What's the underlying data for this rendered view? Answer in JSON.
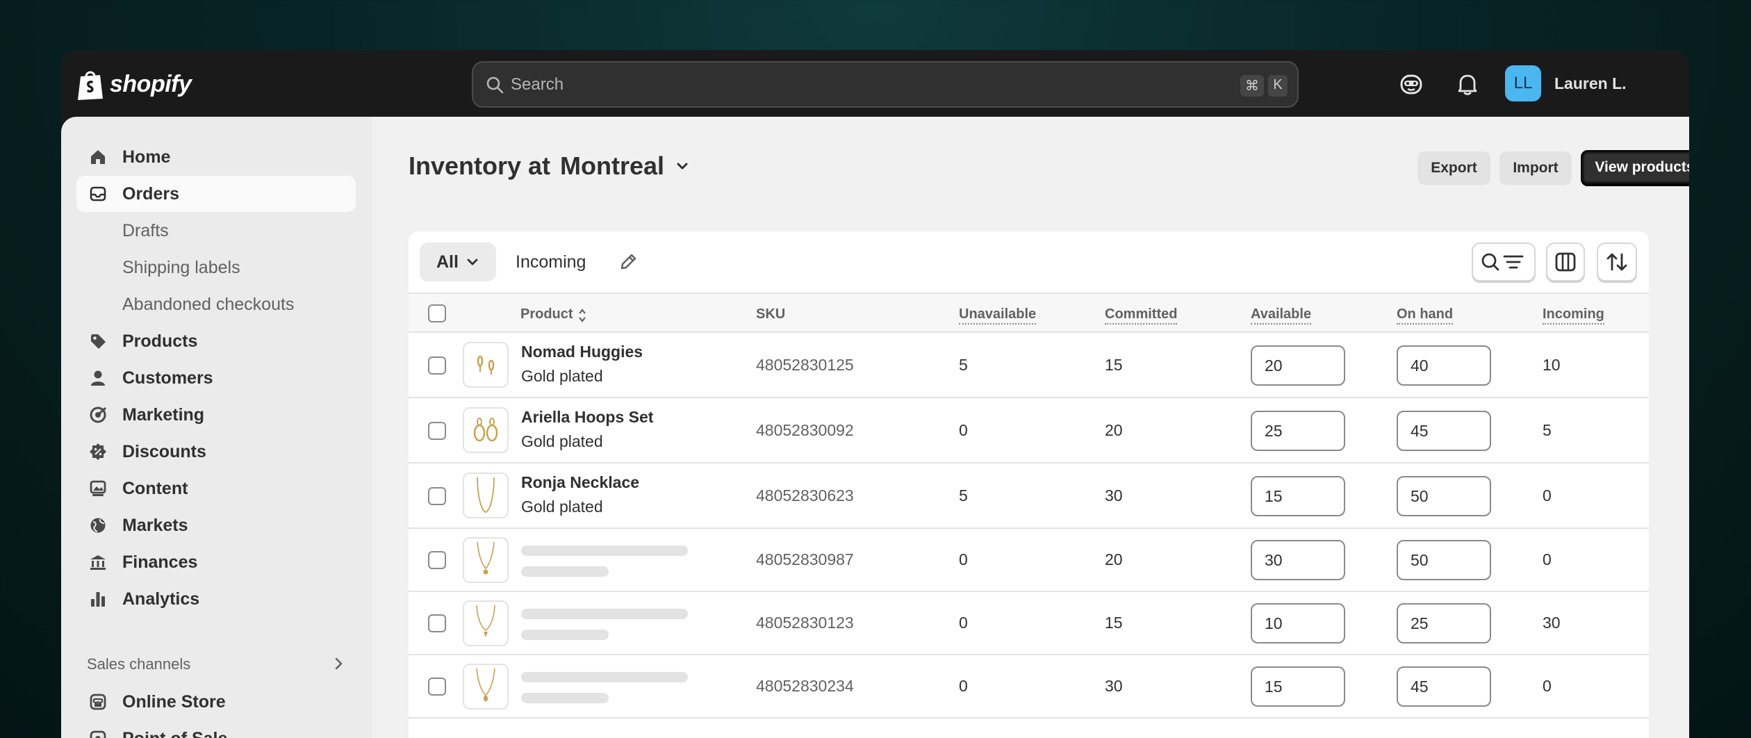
{
  "topbar": {
    "logo_text": "shopify",
    "search_placeholder": "Search",
    "shortcut_keys": [
      "⌘",
      "K"
    ],
    "user_initials": "LL",
    "user_name": "Lauren L."
  },
  "sidebar": {
    "items": [
      {
        "label": "Home",
        "icon": "home-icon"
      },
      {
        "label": "Orders",
        "icon": "orders-icon",
        "active": true
      },
      {
        "label": "Drafts",
        "sub": true
      },
      {
        "label": "Shipping labels",
        "sub": true
      },
      {
        "label": "Abandoned checkouts",
        "sub": true
      },
      {
        "label": "Products",
        "icon": "tag-icon"
      },
      {
        "label": "Customers",
        "icon": "person-icon"
      },
      {
        "label": "Marketing",
        "icon": "target-icon"
      },
      {
        "label": "Discounts",
        "icon": "discount-icon"
      },
      {
        "label": "Content",
        "icon": "content-icon"
      },
      {
        "label": "Markets",
        "icon": "globe-icon"
      },
      {
        "label": "Finances",
        "icon": "bank-icon"
      },
      {
        "label": "Analytics",
        "icon": "bar-chart-icon"
      }
    ],
    "sales_channels_label": "Sales channels",
    "channels": [
      {
        "label": "Online Store",
        "icon": "store-icon"
      },
      {
        "label": "Point of Sale",
        "icon": "pos-icon"
      }
    ]
  },
  "page": {
    "title_prefix": "Inventory at",
    "location": "Montreal",
    "export_label": "Export",
    "import_label": "Import",
    "view_products_label": "View products"
  },
  "tabs": {
    "all_label": "All",
    "incoming_label": "Incoming"
  },
  "table": {
    "headers": {
      "product": "Product",
      "sku": "SKU",
      "unavailable": "Unavailable",
      "committed": "Committed",
      "available": "Available",
      "on_hand": "On hand",
      "incoming": "Incoming"
    },
    "rows": [
      {
        "name": "Nomad Huggies",
        "variant": "Gold plated",
        "sku": "48052830125",
        "unavailable": "5",
        "committed": "15",
        "available": "20",
        "on_hand": "40",
        "incoming": "10"
      },
      {
        "name": "Ariella Hoops Set",
        "variant": "Gold plated",
        "sku": "48052830092",
        "unavailable": "0",
        "committed": "20",
        "available": "25",
        "on_hand": "45",
        "incoming": "5"
      },
      {
        "name": "Ronja Necklace",
        "variant": "Gold plated",
        "sku": "48052830623",
        "unavailable": "5",
        "committed": "30",
        "available": "15",
        "on_hand": "50",
        "incoming": "0"
      },
      {
        "name": "",
        "variant": "",
        "sku": "48052830987",
        "unavailable": "0",
        "committed": "20",
        "available": "30",
        "on_hand": "50",
        "incoming": "0"
      },
      {
        "name": "",
        "variant": "",
        "sku": "48052830123",
        "unavailable": "0",
        "committed": "15",
        "available": "10",
        "on_hand": "25",
        "incoming": "30"
      },
      {
        "name": "",
        "variant": "",
        "sku": "48052830234",
        "unavailable": "0",
        "committed": "30",
        "available": "15",
        "on_hand": "45",
        "incoming": "0"
      }
    ]
  }
}
